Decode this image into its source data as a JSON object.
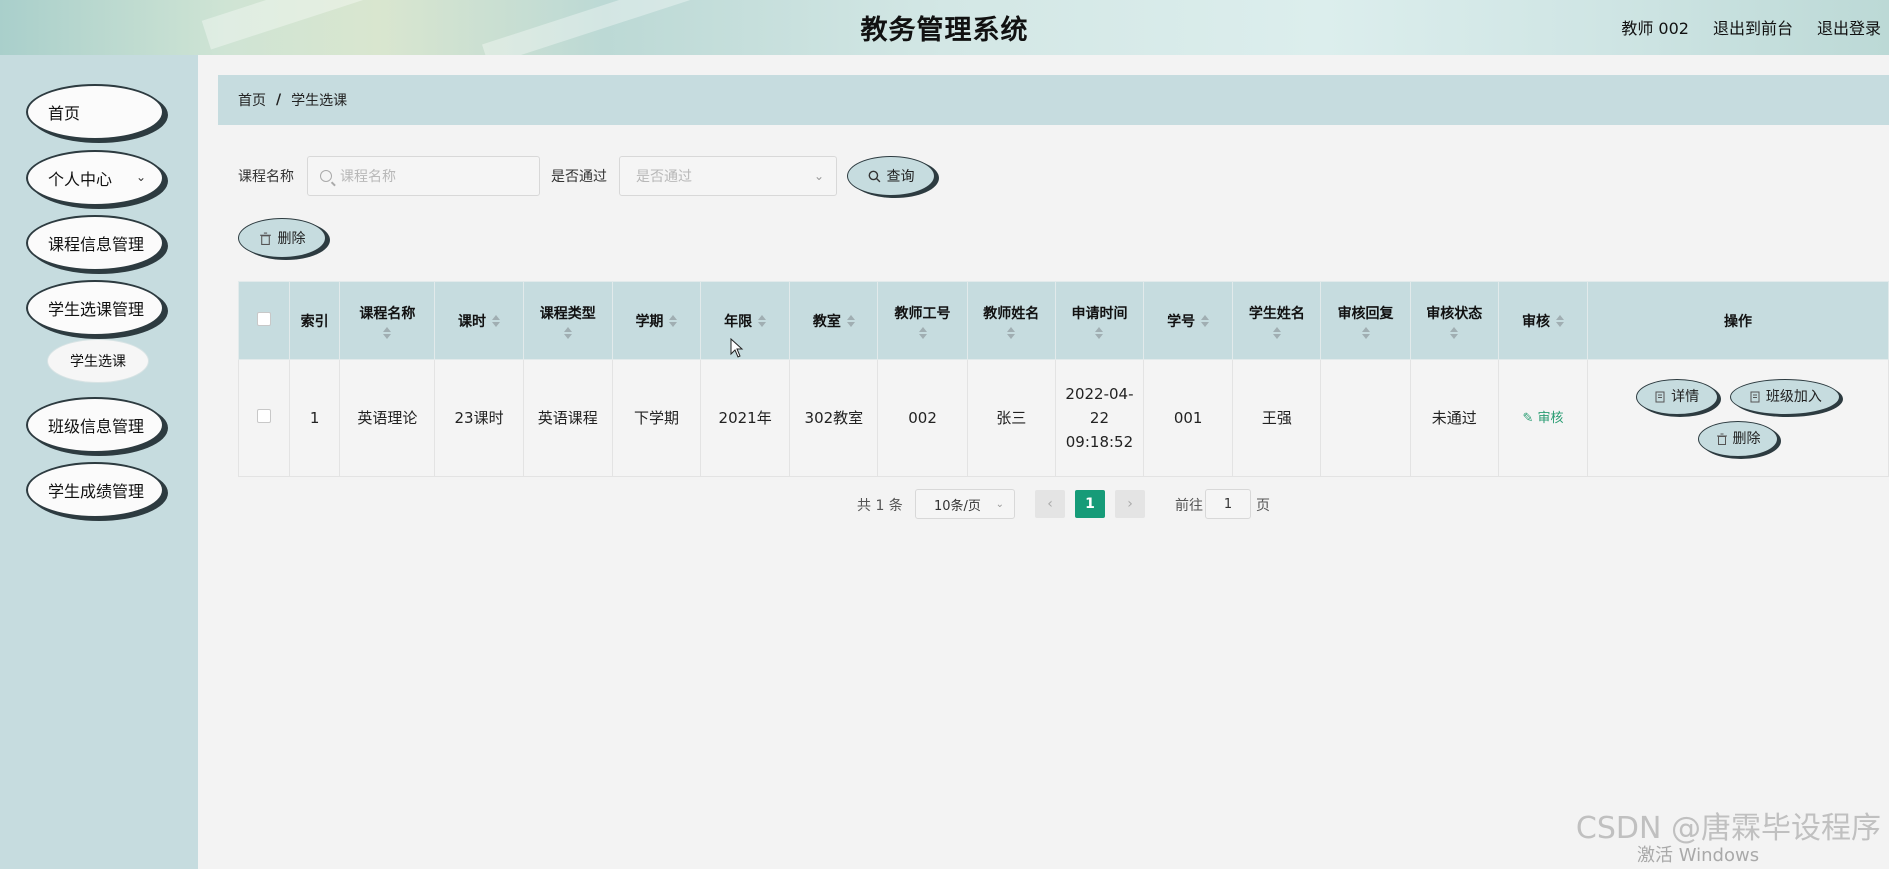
{
  "header": {
    "title": "教务管理系统",
    "user": "教师 002",
    "to_front": "退出到前台",
    "logout": "退出登录"
  },
  "sidebar": {
    "items": [
      {
        "label": "首页"
      },
      {
        "label": "个人中心"
      },
      {
        "label": "课程信息管理"
      },
      {
        "label": "学生选课管理"
      },
      {
        "label": "班级信息管理"
      },
      {
        "label": "学生成绩管理"
      }
    ],
    "sub_item": "学生选课"
  },
  "breadcrumb": {
    "home": "首页",
    "sep": "/",
    "current": "学生选课"
  },
  "search": {
    "course_label": "课程名称",
    "course_placeholder": "课程名称",
    "pass_label": "是否通过",
    "pass_placeholder": "是否通过",
    "query_label": "查询"
  },
  "toolbar": {
    "delete_label": "删除"
  },
  "table": {
    "headers": [
      "索引",
      "课程名称",
      "课时",
      "课程类型",
      "学期",
      "年限",
      "教室",
      "教师工号",
      "教师姓名",
      "申请时间",
      "学号",
      "学生姓名",
      "审核回复",
      "审核状态",
      "审核",
      "操作"
    ],
    "rows": [
      {
        "index": "1",
        "course_name": "英语理论",
        "hours": "23课时",
        "course_type": "英语课程",
        "term": "下学期",
        "year": "2021年",
        "classroom": "302教室",
        "teacher_id": "002",
        "teacher_name": "张三",
        "apply_time": "2022-04-22 09:18:52",
        "student_id": "001",
        "student_name": "王强",
        "reply": "",
        "status": "未通过",
        "audit": "审核",
        "ops": {
          "detail": "详情",
          "join_class": "班级加入",
          "delete": "删除"
        }
      }
    ]
  },
  "pagination": {
    "total": "共 1 条",
    "page_size": "10条/页",
    "current": "1",
    "goto_prefix": "前往",
    "goto_value": "1",
    "goto_suffix": "页"
  },
  "overlay": {
    "watermark": "CSDN @唐霖毕设程序",
    "activate": "激活 Windows"
  },
  "colors": {
    "accent": "#169b78",
    "panel": "#c6dcdf",
    "audit": "#2a9d73"
  }
}
